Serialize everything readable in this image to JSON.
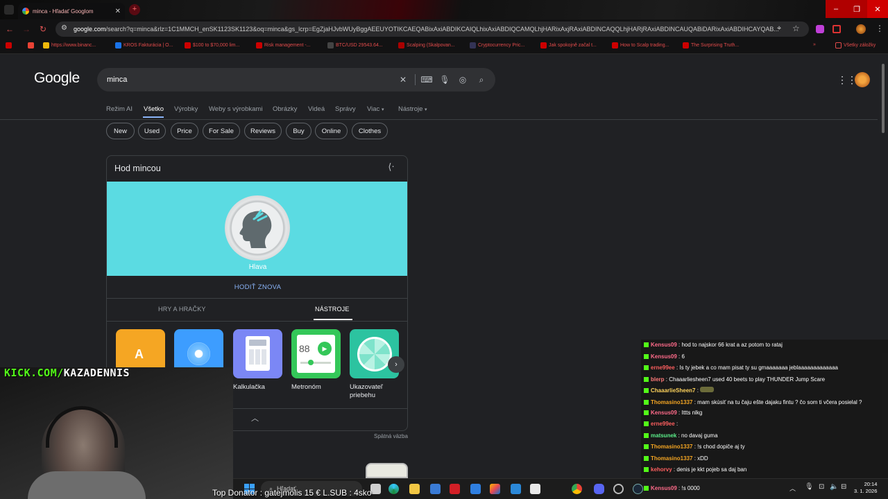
{
  "browser": {
    "tab_title": "minca - Hľadať Googlom",
    "url_host": "google.com",
    "url_rest": "/search?q=minca&rlz=1C1MMCH_enSK1123SK1123&oq=minca&gs_lcrp=EgZjaHJvbWUyBggAEEUYOTIKCAEQABixAxiABDIKCAIQLhixAxiABDIQCAMQLhjHARixAxjRAxiABDINCAQQLhjHARjRAxiABDINCAUQABiDARixAxiABDIHCAYQAB..."
  },
  "bookmarks": [
    "https://www.binanc...",
    "KROS Fakturácia | O...",
    "$100 to $70,000 lim...",
    "Risk management -...",
    "BTC/USD 29543.64...",
    "Scalping (Skalpovan...",
    "Cryptocurrency Pric...",
    "Jak spokojně začal t...",
    "How to Scalp trading...",
    "The Surprising Truth..."
  ],
  "bookmarks_other": "Všetky záložky",
  "google": {
    "logo": "Google",
    "query": "minca",
    "nav": [
      "Režim AI",
      "Všetko",
      "Výrobky",
      "Weby s výrobkami",
      "Obrázky",
      "Videá",
      "Správy",
      "Viac",
      "Nástroje"
    ],
    "chips": [
      "New",
      "Used",
      "Price",
      "For Sale",
      "Reviews",
      "Buy",
      "Online",
      "Clothes"
    ],
    "feedback": "Spätná väzba"
  },
  "coin": {
    "title": "Hod mincou",
    "result": "Hlava",
    "flip_again": "HODIŤ ZNOVA",
    "tab_games": "HRY A HRAČKY",
    "tab_tools": "NÁSTROJE",
    "tools": [
      "Kalkulačka",
      "Metronóm",
      "Ukazovateľ priebehu"
    ],
    "metronome_bpm": "88",
    "colors": {
      "coin_bg": "#5bdbe2"
    }
  },
  "stream": {
    "channel_a": "KICK.COM/",
    "channel_b": "KAZADENNIS",
    "donor": "Top Donator : gatejmolis 15 €  L.SUB : 4sko"
  },
  "chat": [
    {
      "user": "Kensus09",
      "color": "#ff6b8a",
      "text": ": hod to najskor 66 krat a az potom to rataj"
    },
    {
      "user": "Kensus09",
      "color": "#ff6b8a",
      "text": ": 6"
    },
    {
      "user": "erne99ee",
      "color": "#ff5f5f",
      "text": ": Is ty jebek a co mam pisat ty su gmaaaaaaa jeblaaaaaaaaaaaaa"
    },
    {
      "user": "blerp",
      "color": "#ff7a7a",
      "text": ": Chaaarliesheen7 used 40 beets to play THUNDER Jump Scare"
    },
    {
      "user": "ChaaarlieSheen7",
      "color": "#ffd35c",
      "text": ":"
    },
    {
      "user": "Thomasino1337",
      "color": "#f5a623",
      "text": ": mam skúsiť na tu čaju ešte dajaku fintu ? čo som ti včera posielal ?"
    },
    {
      "user": "Kensus09",
      "color": "#ff6b8a",
      "text": ": Ittts nlkg"
    },
    {
      "user": "erne99ee",
      "color": "#ff5f5f",
      "text": ":"
    },
    {
      "user": "matsunek",
      "color": "#5cf08a",
      "text": ": no davaj guma"
    },
    {
      "user": "Thomasino1337",
      "color": "#f5a623",
      "text": ": !s chod dopiče aj ty"
    },
    {
      "user": "Thomasino1337",
      "color": "#f5a623",
      "text": ": xDD"
    },
    {
      "user": "kehorvy",
      "color": "#ff5f5f",
      "text": ": denis je kkt pojeb sa daj ban"
    },
    {
      "user": "Kensus09",
      "color": "#ff6b8a",
      "text": ": !s 0000"
    }
  ],
  "taskbar": {
    "search": "Hľadať",
    "time": "20:14",
    "date": "3. 1. 2026"
  }
}
